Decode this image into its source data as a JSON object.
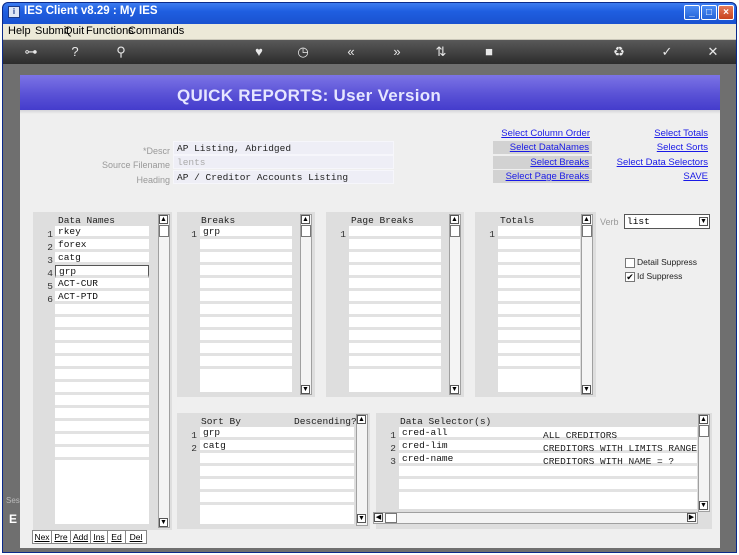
{
  "window": {
    "title": "IES Client v8.29 : My IES",
    "min": "_",
    "max": "□",
    "close": "×"
  },
  "menu": [
    "Help",
    "Submit",
    "Quit",
    "Functions",
    "Commands"
  ],
  "banner_title": "QUICK REPORTS: User Version",
  "form": {
    "descr_label": "*Descr",
    "descr_value": "AP Listing, Abridged",
    "source_label": "Source Filename",
    "source_value": "lents",
    "heading_label": "Heading",
    "heading_value": "AP / Creditor Accounts Listing"
  },
  "links": {
    "col_order": "Select Column Order",
    "datanames": "Select DataNames",
    "breaks": "Select Breaks",
    "page_breaks": "Select Page Breaks",
    "totals": "Select Totals",
    "sorts": "Select Sorts",
    "selectors": "Select Data Selectors",
    "save": "SAVE"
  },
  "data_names": {
    "header": "Data Names",
    "items": [
      {
        "n": "1",
        "v": "rkey"
      },
      {
        "n": "2",
        "v": "forex"
      },
      {
        "n": "3",
        "v": "catg"
      },
      {
        "n": "4",
        "v": "grp"
      },
      {
        "n": "5",
        "v": "ACT-CUR"
      },
      {
        "n": "6",
        "v": "ACT-PTD"
      }
    ]
  },
  "breaks": {
    "header": "Breaks",
    "items": [
      {
        "n": "1",
        "v": "grp"
      }
    ]
  },
  "page_breaks": {
    "header": "Page Breaks",
    "items": [
      {
        "n": "1",
        "v": ""
      }
    ]
  },
  "totals": {
    "header": "Totals",
    "items": [
      {
        "n": "1",
        "v": ""
      }
    ]
  },
  "verb": {
    "label": "Verb",
    "value": "list"
  },
  "options": {
    "detail": "Detail Suppress",
    "detail_checked": false,
    "id": "Id Suppress",
    "id_checked": true
  },
  "sort": {
    "header": "Sort By",
    "desc_header": "Descending?",
    "items": [
      {
        "n": "1",
        "v": "grp"
      },
      {
        "n": "2",
        "v": "catg"
      }
    ]
  },
  "selectors": {
    "header": "Data Selector(s)",
    "items": [
      {
        "n": "1",
        "v": "cred-all",
        "d": "ALL CREDITORS"
      },
      {
        "n": "2",
        "v": "cred-lim",
        "d": "CREDITORS WITH LIMITS RANGE"
      },
      {
        "n": "3",
        "v": "cred-name",
        "d": "CREDITORS WITH NAME = ?"
      }
    ]
  },
  "nav": [
    "Nex",
    "Pre",
    "Add",
    "Ins",
    "Ed",
    "Del"
  ],
  "side_text": {
    "ses": "Ses",
    "e": "E"
  }
}
